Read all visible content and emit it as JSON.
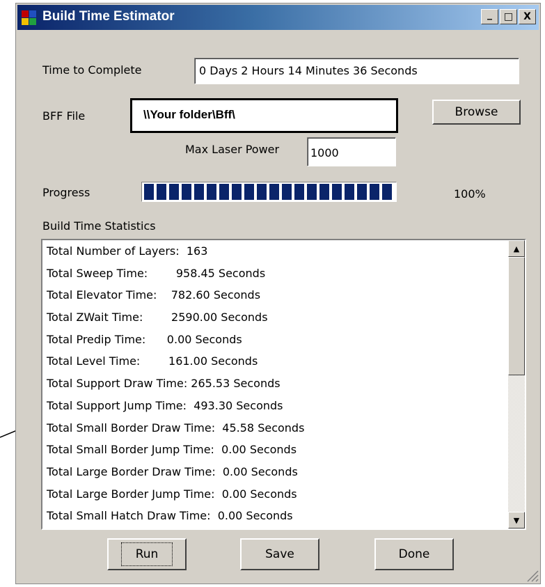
{
  "window": {
    "title": "Build Time Estimator",
    "controls": {
      "minimize": "_",
      "maximize": "□",
      "close": "X"
    }
  },
  "form": {
    "time_label": "Time to Complete",
    "time_value": "0 Days 2 Hours 14 Minutes 36 Seconds",
    "bff_label": "BFF File",
    "bff_value": "\\\\Your folder\\Bff\\",
    "browse_label": "Browse",
    "max_laser_label": "Max Laser Power",
    "max_laser_value": "1000",
    "progress_label": "Progress",
    "progress_fraction": 1.0,
    "progress_text": "100%",
    "stats_label": "Build Time Statistics"
  },
  "stats": [
    "Total Number of Layers:  163",
    "Total Sweep Time:        958.45 Seconds",
    "Total Elevator Time:    782.60 Seconds",
    "Total ZWait Time:        2590.00 Seconds",
    "Total Predip Time:      0.00 Seconds",
    "Total Level Time:        161.00 Seconds",
    "Total Support Draw Time: 265.53 Seconds",
    "Total Support Jump Time:  493.30 Seconds",
    "Total Small Border Draw Time:  45.58 Seconds",
    "Total Small Border Jump Time:  0.00 Seconds",
    "Total Large Border Draw Time:  0.00 Seconds",
    "Total Large Border Jump Time:  0.00 Seconds",
    "Total Small Hatch Draw Time:  0.00 Seconds"
  ],
  "buttons": {
    "run": "Run",
    "save": "Save",
    "done": "Done"
  },
  "colors": {
    "titlebar_start": "#0a246a",
    "titlebar_end": "#a6caf0",
    "progress_fill": "#0a246a",
    "face": "#d4d0c8"
  },
  "icons": {
    "app": "app-window-icon",
    "arrow": "pointer-arrow-icon",
    "grip": "resize-grip-icon"
  }
}
